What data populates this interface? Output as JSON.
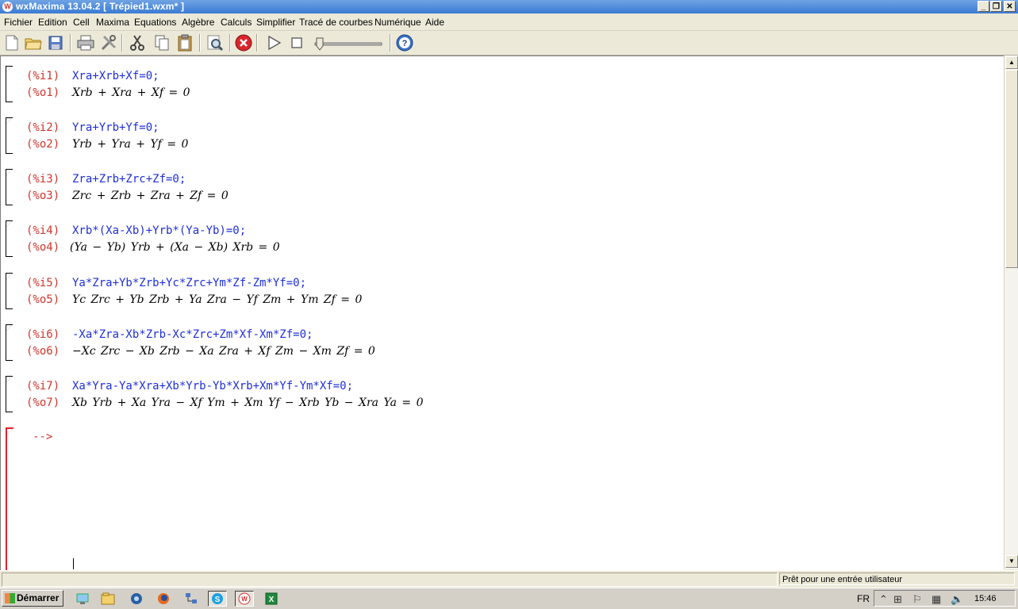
{
  "window": {
    "title": "wxMaxima 13.04.2 [ Trépied1.wxm* ]",
    "app_icon": "wxmaxima-icon",
    "buttons": {
      "minimize": "_",
      "restore": "❐",
      "close": "✕"
    }
  },
  "menu": [
    "Fichier",
    "Edition",
    "Cell",
    "Maxima",
    "Equations",
    "Algèbre",
    "Calculs",
    "Simplifier",
    "Tracé de courbes",
    "Numérique",
    "Aide"
  ],
  "toolbar": {
    "icons": [
      "new-icon",
      "open-icon",
      "save-icon",
      "print-icon",
      "preferences-icon",
      "cut-icon",
      "copy-icon",
      "paste-icon",
      "find-icon",
      "interrupt-icon",
      "play-icon",
      "stop-icon",
      "animation-slider",
      "help-icon"
    ]
  },
  "cells": [
    {
      "in_label": "(%i1)",
      "input": "Xra+Xrb+Xf=0;",
      "out_label": "(%o1)",
      "output": "Xrb + Xra + Xf = 0"
    },
    {
      "in_label": "(%i2)",
      "input": "Yra+Yrb+Yf=0;",
      "out_label": "(%o2)",
      "output": "Yrb + Yra + Yf = 0"
    },
    {
      "in_label": "(%i3)",
      "input": "Zra+Zrb+Zrc+Zf=0;",
      "out_label": "(%o3)",
      "output": "Zrc + Zrb + Zra + Zf = 0"
    },
    {
      "in_label": "(%i4)",
      "input": "Xrb*(Xa-Xb)+Yrb*(Ya-Yb)=0;",
      "out_label": "(%o4)",
      "output": "(Ya − Yb) Yrb + (Xa − Xb) Xrb = 0"
    },
    {
      "in_label": "(%i5)",
      "input": "Ya*Zra+Yb*Zrb+Yc*Zrc+Ym*Zf-Zm*Yf=0;",
      "out_label": "(%o5)",
      "output": "Yc Zrc + Yb Zrb + Ya Zra − Yf Zm + Ym Zf = 0"
    },
    {
      "in_label": "(%i6)",
      "input": "-Xa*Zra-Xb*Zrb-Xc*Zrc+Zm*Xf-Xm*Zf=0;",
      "out_label": "(%o6)",
      "output": "−Xc Zrc − Xb Zrb − Xa Zra + Xf Zm − Xm Zf = 0"
    },
    {
      "in_label": "(%i7)",
      "input": "Xa*Yra-Ya*Xra+Xb*Yrb-Yb*Xrb+Xm*Yf-Ym*Xf=0;",
      "out_label": "(%o7)",
      "output": "Xb Yrb + Xa Yra − Xf Ym + Xm Yf − Xrb Yb − Xra Ya = 0"
    }
  ],
  "prompt": "-->",
  "status": {
    "left": "",
    "right": "Prêt pour une entrée utilisateur"
  },
  "taskbar": {
    "start_label": "Démarrer",
    "lang": "FR",
    "clock": "15:46"
  },
  "colors": {
    "input_label": "#d0342c",
    "input_code": "#1f2fd8",
    "active_cell": "#e3202c"
  }
}
